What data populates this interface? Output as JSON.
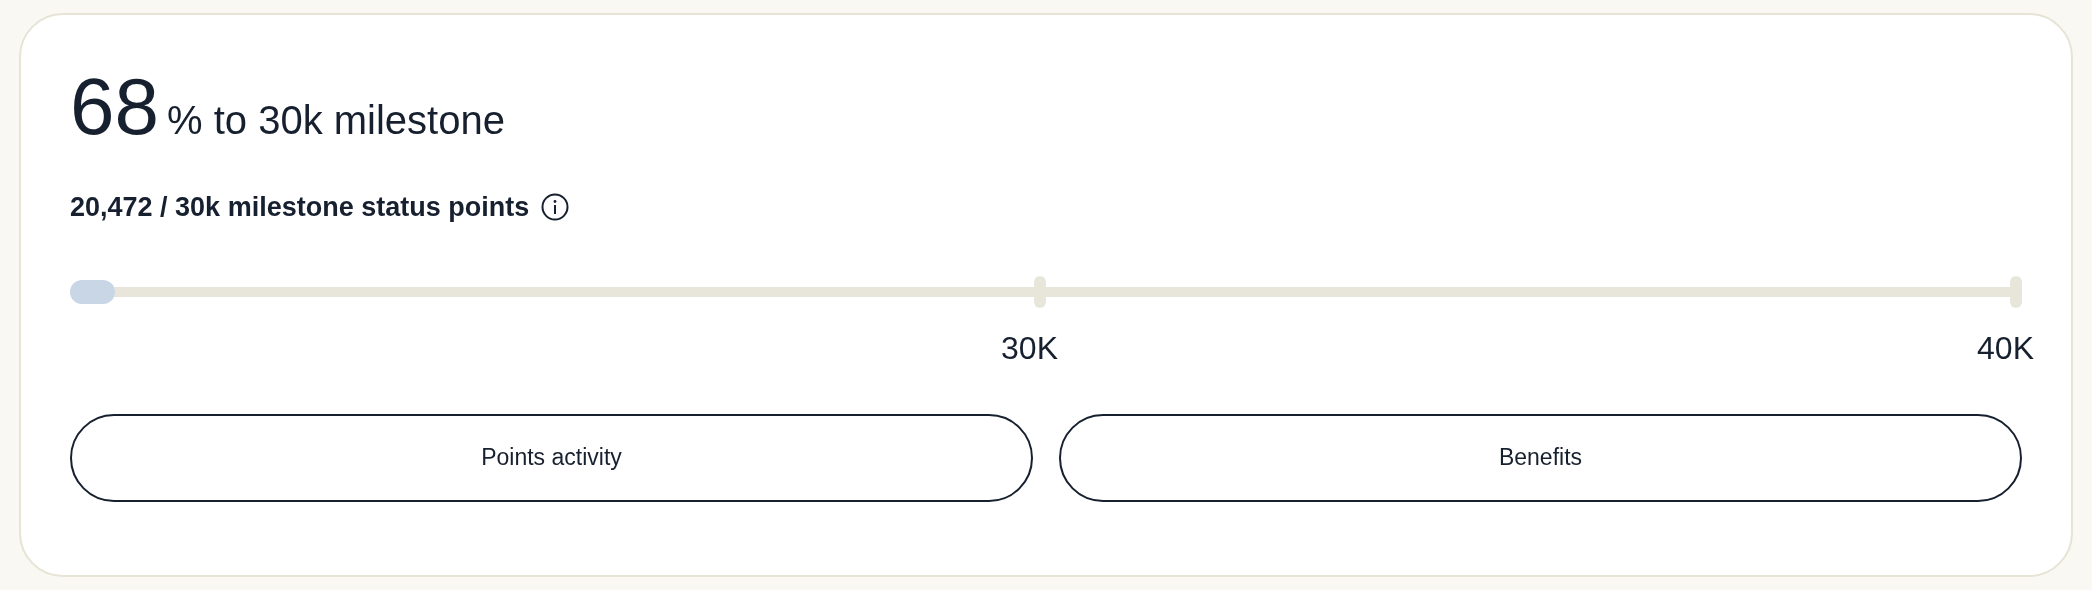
{
  "headline": {
    "value": "68",
    "suffix": "% to 30k milestone"
  },
  "points": {
    "text": "20,472 / 30k milestone status points"
  },
  "progress": {
    "level": 0.023,
    "milestones": [
      {
        "label": "30K"
      },
      {
        "label": "40K"
      }
    ]
  },
  "buttons": [
    "Points activity",
    "Benefits"
  ]
}
